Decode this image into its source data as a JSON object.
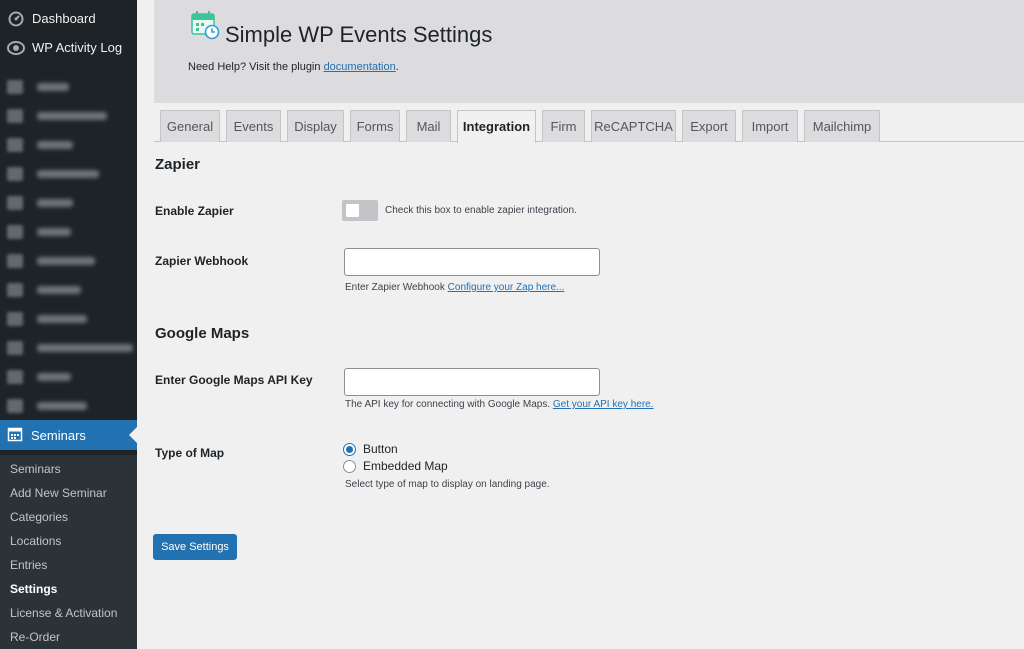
{
  "sidebar": {
    "top_items": [
      {
        "label": "Dashboard",
        "icon": "dashboard-icon"
      },
      {
        "label": "WP Activity Log",
        "icon": "eye-icon"
      }
    ],
    "blurred_items_count_note": "",
    "seminars": {
      "label": "Seminars",
      "icon": "calendar-icon"
    },
    "submenu": [
      {
        "label": "Seminars",
        "current": false
      },
      {
        "label": "Add New Seminar",
        "current": false
      },
      {
        "label": "Categories",
        "current": false
      },
      {
        "label": "Locations",
        "current": false
      },
      {
        "label": "Entries",
        "current": false
      },
      {
        "label": "Settings",
        "current": true
      },
      {
        "label": "License & Activation",
        "current": false
      },
      {
        "label": "Re-Order",
        "current": false
      }
    ]
  },
  "header": {
    "title": "Simple WP Events Settings",
    "help_prefix": "Need Help? Visit the plugin",
    "help_link": "documentation",
    "help_suffix": "."
  },
  "tabs": [
    {
      "label": "General",
      "active": false
    },
    {
      "label": "Events",
      "active": false
    },
    {
      "label": "Display",
      "active": false
    },
    {
      "label": "Forms",
      "active": false
    },
    {
      "label": "Mail",
      "active": false
    },
    {
      "label": "Integration",
      "active": true
    },
    {
      "label": "Firm",
      "active": false
    },
    {
      "label": "ReCAPTCHA",
      "active": false
    },
    {
      "label": "Export",
      "active": false
    },
    {
      "label": "Import",
      "active": false
    },
    {
      "label": "Mailchimp",
      "active": false
    }
  ],
  "zapier": {
    "section_title": "Zapier",
    "enable_label": "Enable Zapier",
    "enable_desc": "Check this box to enable zapier integration.",
    "enabled": false,
    "webhook_label": "Zapier Webhook",
    "webhook_value": "",
    "webhook_desc_prefix": "Enter Zapier Webhook",
    "webhook_desc_link": "Configure your Zap here..."
  },
  "google_maps": {
    "section_title": "Google Maps",
    "api_label": "Enter Google Maps API Key",
    "api_value": "",
    "api_desc_prefix": "The API key for connecting with Google Maps.",
    "api_desc_link": "Get your API key here.",
    "type_label": "Type of Map",
    "options": [
      {
        "label": "Button",
        "checked": true
      },
      {
        "label": "Embedded Map",
        "checked": false
      }
    ],
    "type_desc": "Select type of map to display on landing page."
  },
  "save_label": "Save Settings",
  "colors": {
    "sidebar_bg": "#1d2327",
    "accent": "#2271b1",
    "content_bg": "#f0f0f1"
  }
}
